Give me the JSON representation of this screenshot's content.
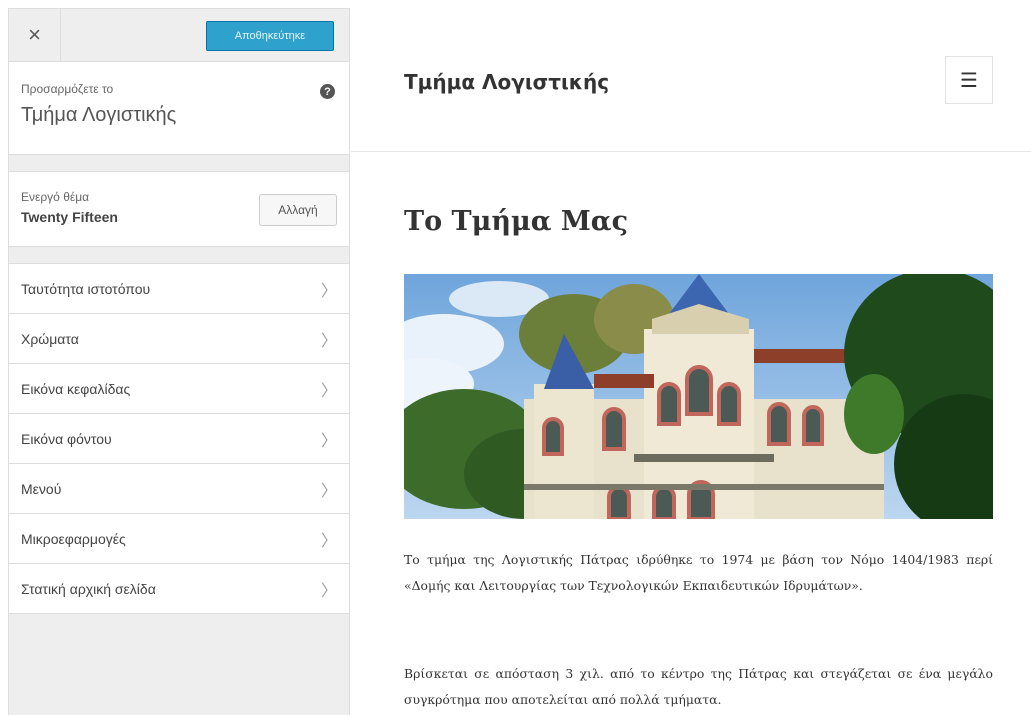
{
  "sidebar": {
    "close_symbol": "×",
    "save_label": "Αποθηκεύτηκε",
    "customizing_label": "Προσαρμόζετε το",
    "site_name": "Τμήμα Λογιστικής",
    "help_symbol": "?",
    "active_theme_label": "Ενεργό θέμα",
    "active_theme_name": "Twenty Fifteen",
    "change_label": "Αλλαγή",
    "items": [
      {
        "label": "Ταυτότητα ιστοτόπου"
      },
      {
        "label": "Χρώματα"
      },
      {
        "label": "Εικόνα κεφαλίδας"
      },
      {
        "label": "Εικόνα φόντου"
      },
      {
        "label": "Μενού"
      },
      {
        "label": "Μικροεφαρμογές"
      },
      {
        "label": "Στατική αρχική σελίδα"
      }
    ],
    "chevron_icon": "chevron-right-icon"
  },
  "preview": {
    "site_title": "Τμήμα Λογιστικής",
    "menu_icon": "hamburger-icon",
    "page_title": "Το Τμήμα Μας",
    "paragraphs": [
      "Το τμήμα της Λογιστικής Πάτρας ιδρύθηκε το 1974 με βάση τον Νόμο 1404/1983 περί «Δομής και Λειτουργίας των Τεχνολογικών Εκπαιδευτικών Ιδρυμάτων».",
      "Βρίσκεται σε απόσταση 3 χιλ. από το κέντρο της Πάτρας και στεγάζεται σε ένα μεγάλο συγκρότημα που αποτελείται από πολλά τμήματα."
    ]
  },
  "colors": {
    "save_button": "#2ea2cc",
    "sidebar_bg": "#eeeeee",
    "text_dark": "#333333"
  }
}
